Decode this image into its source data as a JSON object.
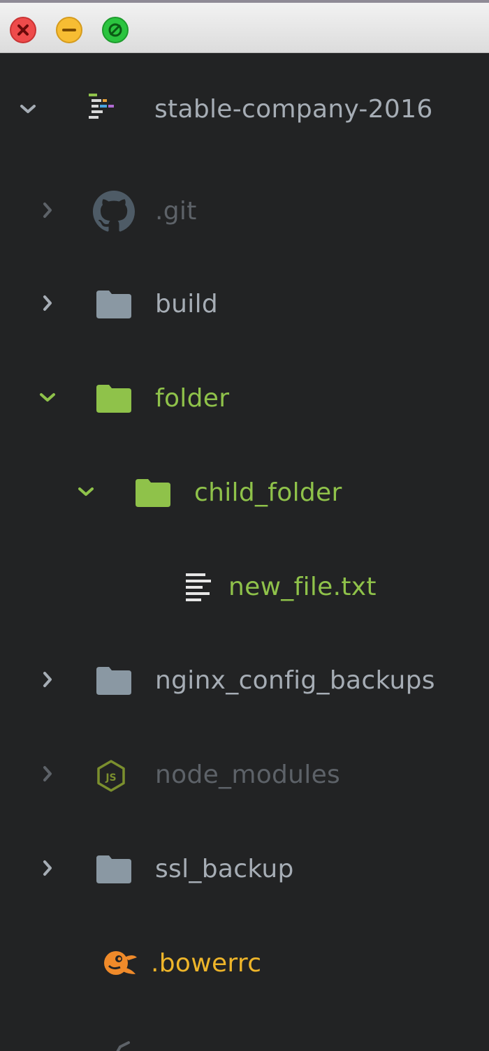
{
  "window": {
    "controls": [
      "close",
      "minimize",
      "maximize"
    ]
  },
  "tree": {
    "root": {
      "label": "stable-company-2016",
      "icon": "project-icon",
      "expanded": true
    },
    "items": [
      {
        "label": ".git",
        "icon": "github-icon",
        "expanded": false,
        "style": "ignored"
      },
      {
        "label": "build",
        "icon": "folder-icon",
        "expanded": false,
        "style": "normal"
      },
      {
        "label": "folder",
        "icon": "folder-icon",
        "expanded": true,
        "style": "added"
      },
      {
        "label": "child_folder",
        "icon": "folder-icon",
        "expanded": true,
        "style": "added"
      },
      {
        "label": "new_file.txt",
        "icon": "text-file-icon",
        "style": "added"
      },
      {
        "label": "nginx_config_backups",
        "icon": "folder-icon",
        "expanded": false,
        "style": "normal"
      },
      {
        "label": "node_modules",
        "icon": "nodejs-icon",
        "expanded": false,
        "style": "ignored"
      },
      {
        "label": "ssl_backup",
        "icon": "folder-icon",
        "expanded": false,
        "style": "normal"
      },
      {
        "label": ".bowerrc",
        "icon": "bower-icon",
        "style": "modified"
      }
    ]
  },
  "colors": {
    "background": "#222324",
    "text_normal": "#a6adb5",
    "text_ignored": "#5d6268",
    "text_added": "#8fc24a",
    "text_modified": "#eeb52a",
    "bower_orange": "#ef8a2a"
  }
}
